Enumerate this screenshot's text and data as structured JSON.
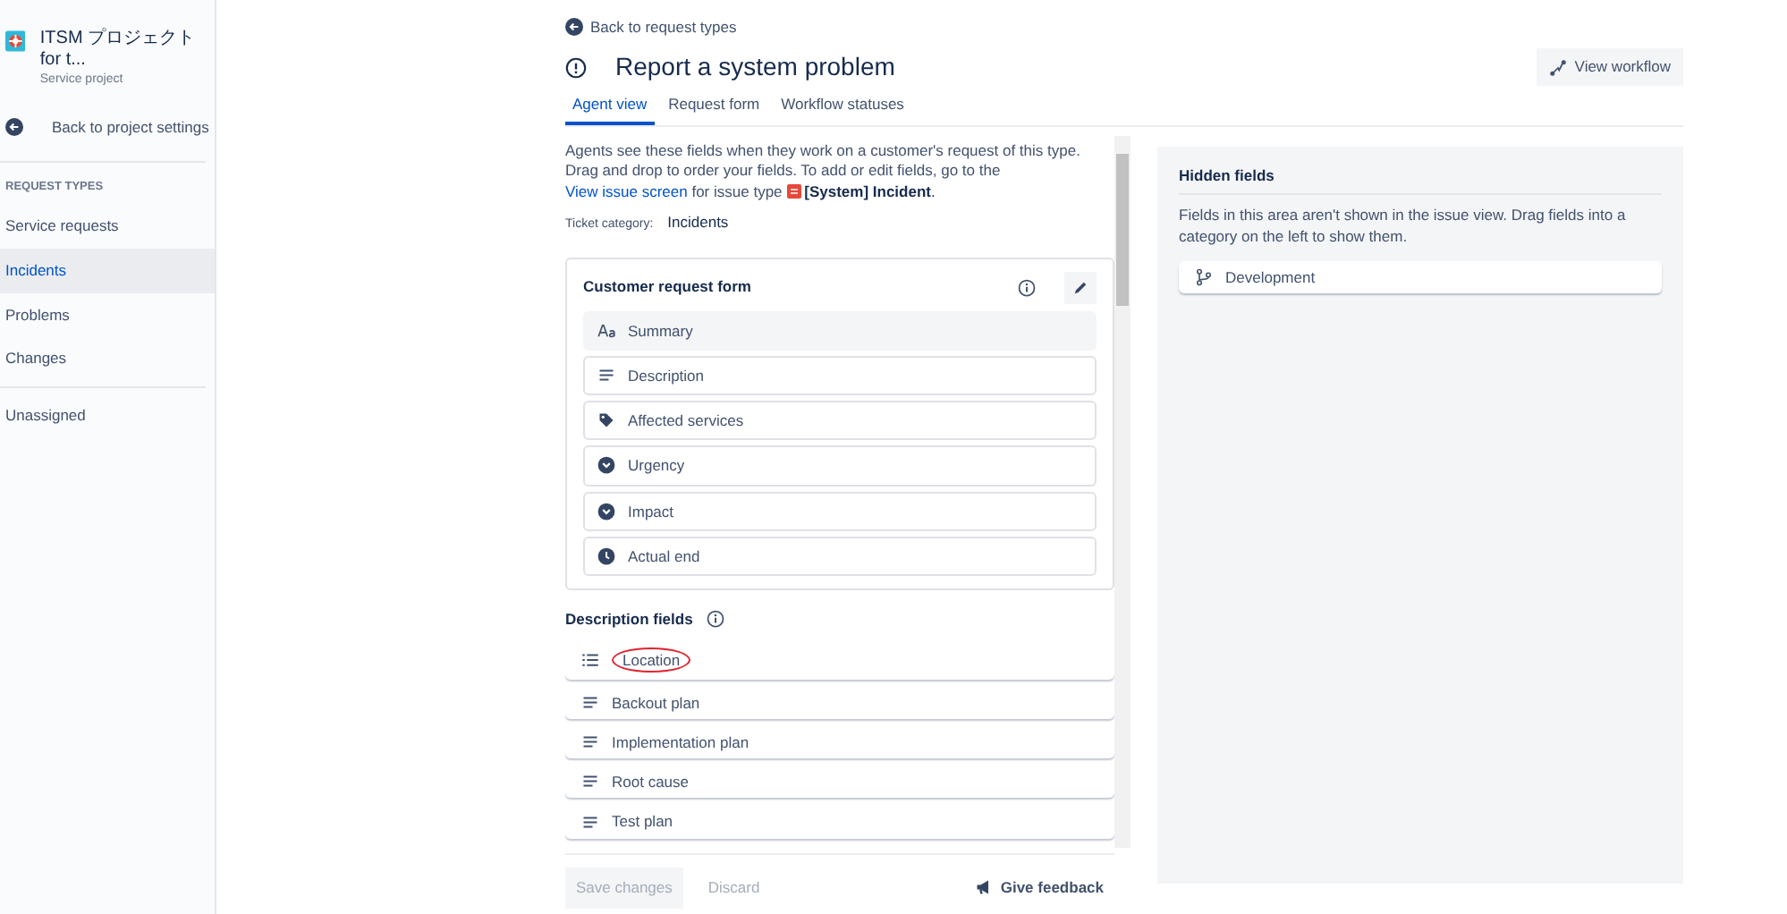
{
  "sidebar": {
    "project_name": "ITSM プロジェクト for t...",
    "project_type": "Service project",
    "back_link": "Back to project settings",
    "section_heading": "REQUEST TYPES",
    "items": [
      {
        "label": "Service requests",
        "selected": false
      },
      {
        "label": "Incidents",
        "selected": true
      },
      {
        "label": "Problems",
        "selected": false
      },
      {
        "label": "Changes",
        "selected": false
      }
    ],
    "extra_items": [
      {
        "label": "Unassigned",
        "selected": false
      }
    ]
  },
  "back_link": "Back to request types",
  "title": "Report a system problem",
  "view_workflow_button": "View workflow",
  "tabs": [
    {
      "label": "Agent view",
      "selected": true
    },
    {
      "label": "Request form",
      "selected": false
    },
    {
      "label": "Workflow statuses",
      "selected": false
    }
  ],
  "intro": {
    "text_before": "Agents see these fields when they work on a customer's request of this type. Drag and drop to order your fields. To add or edit fields, go to the",
    "link": "View issue screen",
    "text_after": "for issue type",
    "issue_type": "**[System] Incident**."
  },
  "ticket_category": {
    "label": "Ticket category:",
    "value": "Incidents"
  },
  "customer_request_form": {
    "title": "Customer request form",
    "fields": [
      {
        "label": "Summary",
        "kind": "short",
        "locked": true,
        "circled": false
      },
      {
        "label": "Description",
        "kind": "paragraph",
        "locked": false,
        "circled": false
      },
      {
        "label": "Affected services",
        "kind": "tag",
        "locked": false,
        "circled": false
      },
      {
        "label": "Urgency",
        "kind": "select",
        "locked": false,
        "circled": false
      },
      {
        "label": "Impact",
        "kind": "select",
        "locked": false,
        "circled": false
      },
      {
        "label": "Actual end",
        "kind": "date",
        "locked": false,
        "circled": false
      }
    ]
  },
  "description_fields": {
    "title": "Description fields",
    "fields": [
      {
        "label": "Location",
        "kind": "list",
        "locked": false,
        "circled": true
      },
      {
        "label": "Backout plan",
        "kind": "paragraph",
        "locked": false,
        "circled": false
      },
      {
        "label": "Implementation plan",
        "kind": "paragraph",
        "locked": false,
        "circled": false
      },
      {
        "label": "Root cause",
        "kind": "paragraph",
        "locked": false,
        "circled": false
      },
      {
        "label": "Test plan",
        "kind": "paragraph",
        "locked": false,
        "circled": false
      }
    ]
  },
  "footer": {
    "save_button": {
      "label": "Save changes",
      "disabled": true
    },
    "discard_button": "Discard",
    "feedback_button": "Give feedback"
  },
  "hidden_fields": {
    "title": "Hidden fields",
    "description": "Fields in this area aren't shown in the issue view. Drag fields into a category on the left to show them.",
    "fields": [
      {
        "label": "Development",
        "kind": "branch",
        "locked": false,
        "circled": false
      }
    ]
  }
}
